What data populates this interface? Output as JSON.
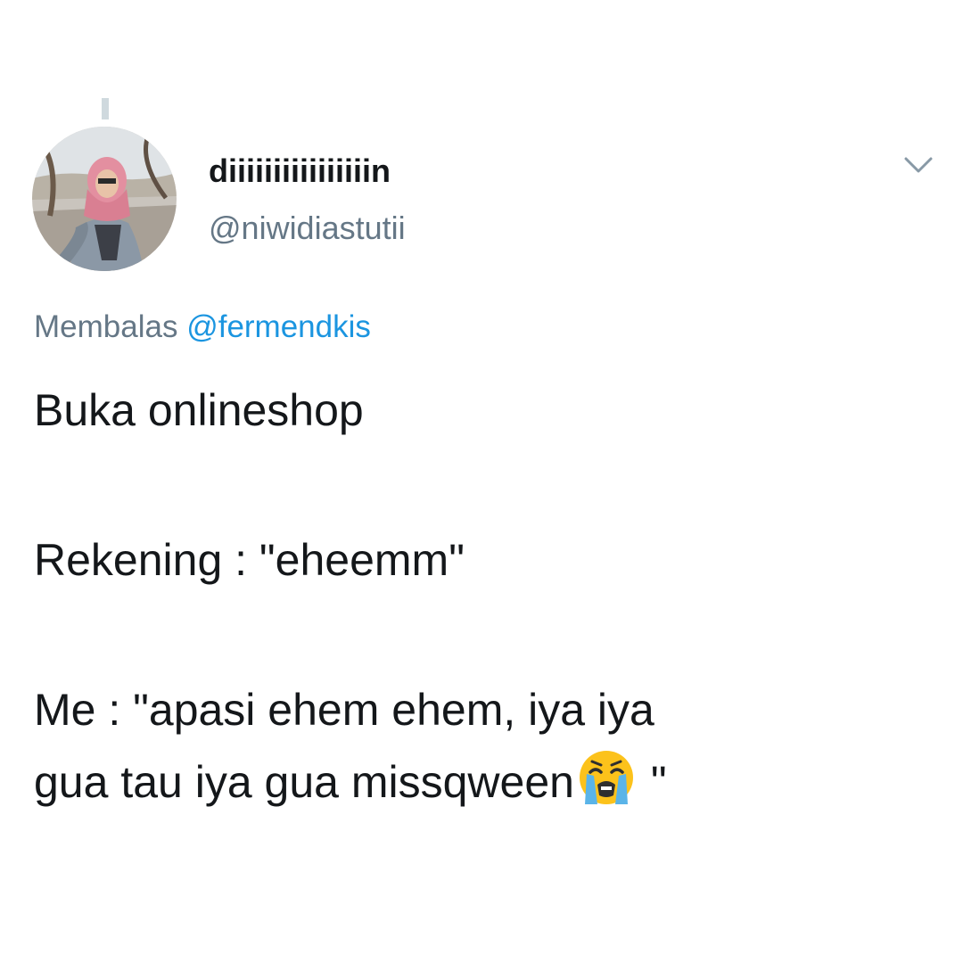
{
  "tweet": {
    "display_name": "diiiiiiiiiiiiiiiin",
    "handle": "@niwidiastutii",
    "reply_prefix": "Membalas",
    "reply_mention": "@fermendkis",
    "lines": [
      "Buka onlineshop",
      "Rekening : \"eheemm\"",
      "Me : \"apasi ehem ehem, iya iya",
      "gua tau iya gua missqween"
    ],
    "line_end_suffix": " \"",
    "emoji": "loudly-crying-face-emoji"
  },
  "icons": {
    "caret": "chevron-down-icon",
    "avatar": "profile-photo"
  },
  "colors": {
    "text": "#14171a",
    "muted": "#657786",
    "link": "#1b95e0",
    "thread_line": "#cfd9de"
  }
}
